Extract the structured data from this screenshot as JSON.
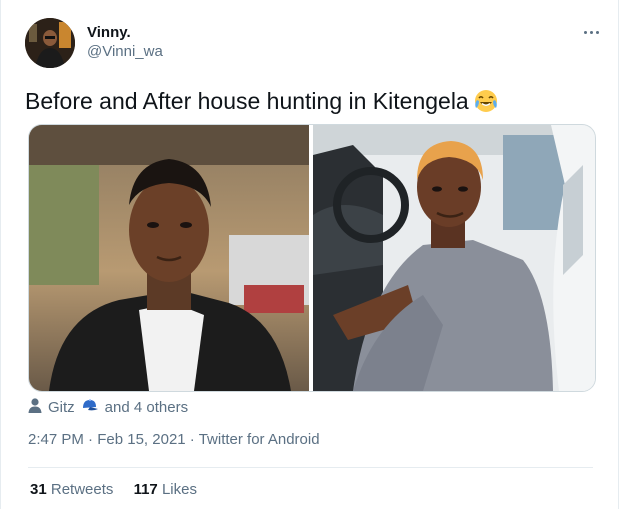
{
  "tweet": {
    "author": {
      "display_name": "Vinny.",
      "handle": "@Vinni_wa",
      "avatar_icon": "avatar-photo"
    },
    "more_icon": "more-options-icon",
    "text": "Before and After house hunting in Kitengela",
    "emoji": "face-with-tears-of-joy",
    "media": [
      {
        "icon": "photo-before"
      },
      {
        "icon": "photo-after"
      }
    ],
    "liked_by": {
      "icon": "person-icon",
      "name": "Gitz",
      "badge_icon": "blue-cap-icon",
      "others": "and 4 others"
    },
    "meta": {
      "time": "2:47 PM",
      "separator1": " · ",
      "date": "Feb 15, 2021",
      "separator2": " · ",
      "source": "Twitter for Android"
    },
    "stats": {
      "retweets_count": "31",
      "retweets_label": "Retweets",
      "likes_count": "117",
      "likes_label": "Likes"
    }
  },
  "colors": {
    "primary_text": "#0f1419",
    "secondary_text": "#5b7083",
    "border": "#cfd9de",
    "divider": "#e6ecf0"
  }
}
